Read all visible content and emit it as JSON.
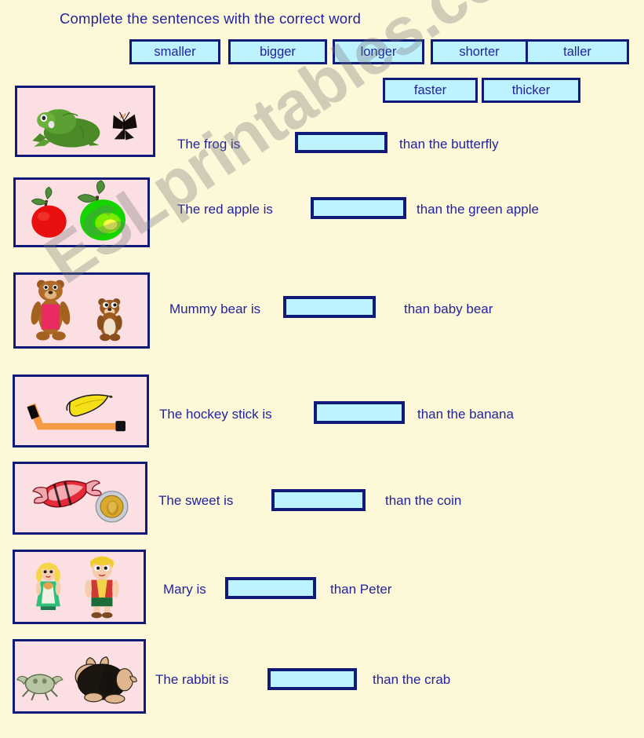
{
  "worksheet": {
    "title": "Complete  the sentences with  the correct word",
    "watermark": "ESLprintables.com",
    "colors": {
      "page_background": "#fdf8d8",
      "text": "#23239c",
      "border": "#101a78",
      "chip_fill": "#bdf2ff",
      "picture_fill": "#fbdfe2"
    }
  },
  "word_bank": {
    "row1": [
      {
        "label": "smaller"
      },
      {
        "label": "bigger"
      },
      {
        "label": "longer"
      },
      {
        "label": "shorter"
      },
      {
        "label": "taller"
      }
    ],
    "row2": [
      {
        "label": "faster"
      },
      {
        "label": "thicker"
      }
    ]
  },
  "exercises": [
    {
      "id": "frog",
      "picture": "frog-and-butterfly",
      "prefix": "The frog is",
      "answer": "",
      "suffix": "than the butterfly"
    },
    {
      "id": "apple",
      "picture": "red-apple-and-green-apple",
      "prefix": "The red apple is",
      "answer": "",
      "suffix": "than the green apple"
    },
    {
      "id": "bear",
      "picture": "mummy-bear-and-baby-bear",
      "prefix": "Mummy bear is",
      "answer": "",
      "suffix": "than baby bear"
    },
    {
      "id": "hockey",
      "picture": "hockey-stick-and-banana",
      "prefix": "The hockey stick is",
      "answer": "",
      "suffix": "than the banana"
    },
    {
      "id": "sweet",
      "picture": "sweet-and-coin",
      "prefix": "The sweet is",
      "answer": "",
      "suffix": "than the coin"
    },
    {
      "id": "mary",
      "picture": "mary-and-peter",
      "prefix": "Mary is",
      "answer": "",
      "suffix": "than Peter"
    },
    {
      "id": "rabbit",
      "picture": "rabbit-and-crab",
      "prefix": "The rabbit is",
      "answer": "",
      "suffix": "than the crab"
    }
  ]
}
